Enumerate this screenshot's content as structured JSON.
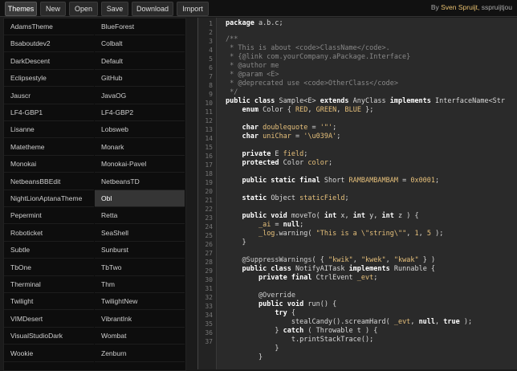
{
  "toolbar": {
    "buttons": [
      "Themes",
      "New",
      "Open",
      "Save",
      "Download",
      "Import"
    ],
    "author_prefix": "By",
    "author_name": "Sven Spruijt,",
    "author_suffix": "sspruijtjou"
  },
  "themes": {
    "left": [
      "AdamsTheme",
      "Bsaboutdev2",
      "DarkDescent",
      "Eclipsestyle",
      "Jauscr",
      "LF4-GBP1",
      "Lisanne",
      "Matetheme",
      "Monokai",
      "NetbeansBBEdit",
      "NightLionAptanaTheme",
      "Pepermint",
      "Roboticket",
      "Subtle",
      "TbOne",
      "Therminal",
      "Twilight",
      "VIMDesert",
      "VisualStudioDark",
      "Wookie"
    ],
    "right": [
      "BlueForest",
      "Colbalt",
      "Default",
      "GitHub",
      "JavaOG",
      "LF4-GBP2",
      "Lobsweb",
      "Monark",
      "Monokai-Pavel",
      "NetbeansTD",
      "Obl",
      "Retta",
      "SeaShell",
      "Sunburst",
      "TbTwo",
      "Thm",
      "TwilightNew",
      "VibrantInk",
      "Wombat",
      "Zenburn"
    ],
    "selected": "Obl"
  },
  "editor": {
    "line_numbers": [
      "1",
      "2",
      "3",
      "4",
      "5",
      "6",
      "7",
      "8",
      "9",
      "10",
      "11",
      "12",
      "13",
      "14",
      "15",
      "16",
      "17",
      "18",
      "19",
      "20",
      "21",
      "22",
      "23",
      "24",
      "25",
      "26",
      "27",
      "28",
      "29",
      "30",
      "31",
      "32",
      "33",
      "34",
      "35",
      "36",
      "37"
    ]
  }
}
